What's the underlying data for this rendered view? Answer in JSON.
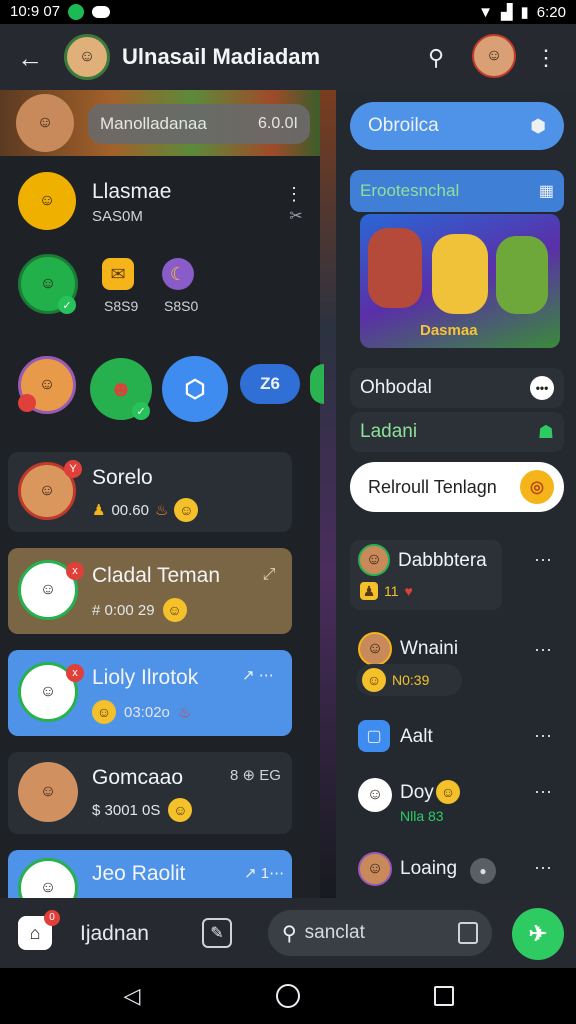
{
  "status_bar": {
    "time_left": "10:9 07",
    "time_right": "6:20"
  },
  "app_bar": {
    "title": "Ulnasail Madiadam"
  },
  "left_panel": {
    "banner": {
      "name": "Manolladanaa",
      "value": "6.0.0I"
    },
    "profile": {
      "name": "Llasmae",
      "sub": "SAS0M"
    },
    "quick_items": [
      {
        "label": "S8S9"
      },
      {
        "label": "S8S0"
      }
    ],
    "story_badge": "Z6",
    "chats": [
      {
        "name": "Sorelo",
        "meta": "00.60",
        "bg": "#2a2f35",
        "badge": "Y"
      },
      {
        "name": "Cladal Teman",
        "meta": "# 0:00 29",
        "bg": "#7a6644",
        "badge": "x"
      },
      {
        "name": "Lioly Ilrotok",
        "meta": "03:02o",
        "bg": "#4f93e8",
        "badge": "x"
      },
      {
        "name": "Gomcaao",
        "meta": "$ 3001 0S",
        "bg": "#2a2f35",
        "badge": ""
      },
      {
        "name": "Jeo Raolit",
        "meta": "",
        "bg": "#4f93e8",
        "badge": "x"
      }
    ],
    "chat_time_3": "↗ ⋯",
    "chat_time_4": "8 ⊕ EG",
    "chat_time_5": "↗ 1⋯"
  },
  "right_panel": {
    "top_button": "Obroilca",
    "promo": {
      "title": "Erootesnchal",
      "caption": "Dasmaa"
    },
    "items": [
      {
        "label": "Ohbodal"
      },
      {
        "label": "Ladani"
      },
      {
        "label": "Relroull Tenlagn"
      }
    ],
    "list": [
      {
        "name": "Dabbbtera",
        "meta": "11"
      },
      {
        "name": "Wnaini",
        "meta": "N0:39"
      },
      {
        "name": "Aalt",
        "meta": ""
      },
      {
        "name": "Doy",
        "meta": "Nlla 83"
      },
      {
        "name": "Loaing",
        "meta": ""
      }
    ]
  },
  "bottom_bar": {
    "home_label": "Ijadnan",
    "search_placeholder": "sanclat",
    "home_badge": "0"
  },
  "colors": {
    "accent_blue": "#4f93e8",
    "fab_green": "#2ecb63",
    "chat_brown": "#7a6644"
  }
}
